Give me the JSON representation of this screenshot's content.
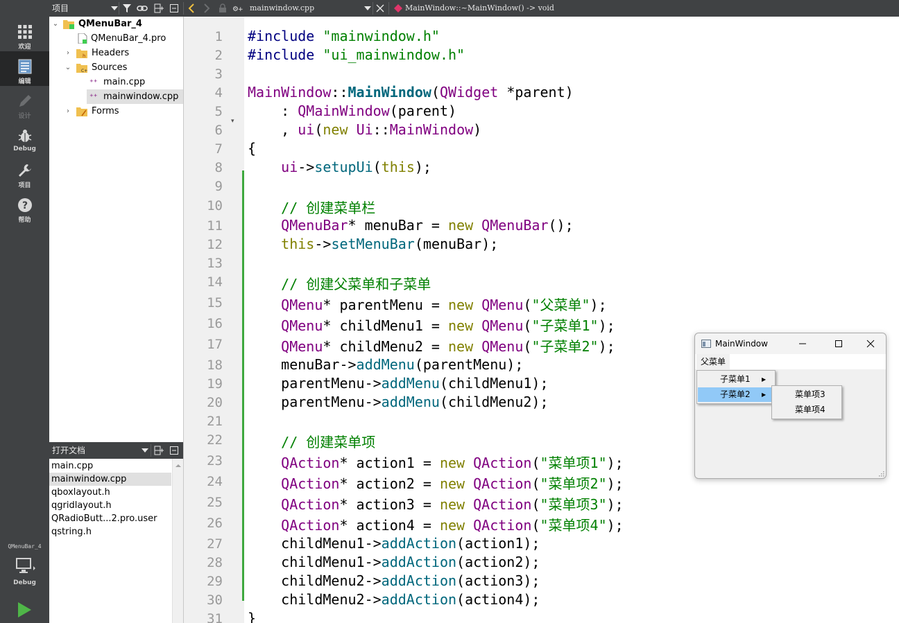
{
  "modebar": {
    "modes": [
      {
        "label": "欢迎",
        "icon": "grid-icon"
      },
      {
        "label": "编辑",
        "icon": "document-icon"
      },
      {
        "label": "设计",
        "icon": "pencil-icon"
      },
      {
        "label": "Debug",
        "icon": "bug-icon"
      },
      {
        "label": "项目",
        "icon": "wrench-icon"
      },
      {
        "label": "帮助",
        "icon": "help-icon"
      }
    ],
    "kit": {
      "project": "QMenuBar_4",
      "build": "Debug"
    }
  },
  "toolbar": {
    "pane_title": "项目",
    "file_name": "mainwindow.cpp",
    "symbol": "MainWindow::~MainWindow() -> void"
  },
  "project_tree": {
    "root": "QMenuBar_4",
    "items": [
      {
        "label": "QMenuBar_4.pro"
      },
      {
        "label": "Headers"
      },
      {
        "label": "Sources"
      },
      {
        "label": "main.cpp"
      },
      {
        "label": "mainwindow.cpp"
      },
      {
        "label": "Forms"
      }
    ]
  },
  "open_documents": {
    "title": "打开文档",
    "items": [
      "main.cpp",
      "mainwindow.cpp",
      "qboxlayout.h",
      "qgridlayout.h",
      "QRadioButt...2.pro.user",
      "qstring.h"
    ]
  },
  "editor": {
    "line_numbers": [
      "1",
      "2",
      "3",
      "4",
      "5",
      "6",
      "7",
      "8",
      "9",
      "10",
      "11",
      "12",
      "13",
      "14",
      "15",
      "16",
      "17",
      "18",
      "19",
      "20",
      "21",
      "22",
      "23",
      "24",
      "25",
      "26",
      "27",
      "28",
      "29",
      "30",
      "31"
    ],
    "lines": [
      [
        [
          "pp",
          "#include "
        ],
        [
          "str",
          "\"mainwindow.h\""
        ]
      ],
      [
        [
          "pp",
          "#include "
        ],
        [
          "str",
          "\"ui_mainwindow.h\""
        ]
      ],
      [],
      [
        [
          "typ",
          "MainWindow"
        ],
        [
          "",
          "::"
        ],
        [
          "fnb",
          "MainWindow"
        ],
        [
          "",
          "("
        ],
        [
          "typ",
          "QWidget"
        ],
        [
          "",
          " *parent)"
        ]
      ],
      [
        [
          "",
          "    : "
        ],
        [
          "typ",
          "QMainWindow"
        ],
        [
          "",
          "(parent)"
        ]
      ],
      [
        [
          "",
          "    , "
        ],
        [
          "typ",
          "ui"
        ],
        [
          "",
          "("
        ],
        [
          "kw",
          "new"
        ],
        [
          "",
          " "
        ],
        [
          "typ",
          "Ui"
        ],
        [
          "",
          "::"
        ],
        [
          "typ",
          "MainWindow"
        ],
        [
          "",
          ")"
        ]
      ],
      [
        [
          "",
          "{"
        ]
      ],
      [
        [
          "",
          "    "
        ],
        [
          "typ",
          "ui"
        ],
        [
          "",
          "->"
        ],
        [
          "fn",
          "setupUi"
        ],
        [
          "",
          "("
        ],
        [
          "kw",
          "this"
        ],
        [
          "",
          ");"
        ]
      ],
      [],
      [
        [
          "cmt",
          "    // 创建菜单栏"
        ]
      ],
      [
        [
          "",
          "    "
        ],
        [
          "typ",
          "QMenuBar"
        ],
        [
          "",
          "* menuBar = "
        ],
        [
          "kw",
          "new"
        ],
        [
          "",
          " "
        ],
        [
          "typ",
          "QMenuBar"
        ],
        [
          "",
          "();"
        ]
      ],
      [
        [
          "",
          "    "
        ],
        [
          "kw",
          "this"
        ],
        [
          "",
          "->"
        ],
        [
          "fn",
          "setMenuBar"
        ],
        [
          "",
          "(menuBar);"
        ]
      ],
      [],
      [
        [
          "cmt",
          "    // 创建父菜单和子菜单"
        ]
      ],
      [
        [
          "",
          "    "
        ],
        [
          "typ",
          "QMenu"
        ],
        [
          "",
          "* parentMenu = "
        ],
        [
          "kw",
          "new"
        ],
        [
          "",
          " "
        ],
        [
          "typ",
          "QMenu"
        ],
        [
          "",
          "("
        ],
        [
          "str",
          "\"父菜单\""
        ],
        [
          "",
          ");"
        ]
      ],
      [
        [
          "",
          "    "
        ],
        [
          "typ",
          "QMenu"
        ],
        [
          "",
          "* childMenu1 = "
        ],
        [
          "kw",
          "new"
        ],
        [
          "",
          " "
        ],
        [
          "typ",
          "QMenu"
        ],
        [
          "",
          "("
        ],
        [
          "str",
          "\"子菜单1\""
        ],
        [
          "",
          ");"
        ]
      ],
      [
        [
          "",
          "    "
        ],
        [
          "typ",
          "QMenu"
        ],
        [
          "",
          "* childMenu2 = "
        ],
        [
          "kw",
          "new"
        ],
        [
          "",
          " "
        ],
        [
          "typ",
          "QMenu"
        ],
        [
          "",
          "("
        ],
        [
          "str",
          "\"子菜单2\""
        ],
        [
          "",
          ");"
        ]
      ],
      [
        [
          "",
          "    menuBar->"
        ],
        [
          "fn",
          "addMenu"
        ],
        [
          "",
          "(parentMenu);"
        ]
      ],
      [
        [
          "",
          "    parentMenu->"
        ],
        [
          "fn",
          "addMenu"
        ],
        [
          "",
          "(childMenu1);"
        ]
      ],
      [
        [
          "",
          "    parentMenu->"
        ],
        [
          "fn",
          "addMenu"
        ],
        [
          "",
          "(childMenu2);"
        ]
      ],
      [],
      [
        [
          "cmt",
          "    // 创建菜单项"
        ]
      ],
      [
        [
          "",
          "    "
        ],
        [
          "typ",
          "QAction"
        ],
        [
          "",
          "* action1 = "
        ],
        [
          "kw",
          "new"
        ],
        [
          "",
          " "
        ],
        [
          "typ",
          "QAction"
        ],
        [
          "",
          "("
        ],
        [
          "str",
          "\"菜单项1\""
        ],
        [
          "",
          ");"
        ]
      ],
      [
        [
          "",
          "    "
        ],
        [
          "typ",
          "QAction"
        ],
        [
          "",
          "* action2 = "
        ],
        [
          "kw",
          "new"
        ],
        [
          "",
          " "
        ],
        [
          "typ",
          "QAction"
        ],
        [
          "",
          "("
        ],
        [
          "str",
          "\"菜单项2\""
        ],
        [
          "",
          ");"
        ]
      ],
      [
        [
          "",
          "    "
        ],
        [
          "typ",
          "QAction"
        ],
        [
          "",
          "* action3 = "
        ],
        [
          "kw",
          "new"
        ],
        [
          "",
          " "
        ],
        [
          "typ",
          "QAction"
        ],
        [
          "",
          "("
        ],
        [
          "str",
          "\"菜单项3\""
        ],
        [
          "",
          ");"
        ]
      ],
      [
        [
          "",
          "    "
        ],
        [
          "typ",
          "QAction"
        ],
        [
          "",
          "* action4 = "
        ],
        [
          "kw",
          "new"
        ],
        [
          "",
          " "
        ],
        [
          "typ",
          "QAction"
        ],
        [
          "",
          "("
        ],
        [
          "str",
          "\"菜单项4\""
        ],
        [
          "",
          ");"
        ]
      ],
      [
        [
          "",
          "    childMenu1->"
        ],
        [
          "fn",
          "addAction"
        ],
        [
          "",
          "(action1);"
        ]
      ],
      [
        [
          "",
          "    childMenu1->"
        ],
        [
          "fn",
          "addAction"
        ],
        [
          "",
          "(action2);"
        ]
      ],
      [
        [
          "",
          "    childMenu2->"
        ],
        [
          "fn",
          "addAction"
        ],
        [
          "",
          "(action3);"
        ]
      ],
      [
        [
          "",
          "    childMenu2->"
        ],
        [
          "fn",
          "addAction"
        ],
        [
          "",
          "(action4);"
        ]
      ],
      [
        [
          "",
          "}"
        ]
      ]
    ]
  },
  "app_window": {
    "title": "MainWindow",
    "menubar_label": "父菜单",
    "parent_menu_items": [
      "子菜单1",
      "子菜单2"
    ],
    "child_menu_items": [
      "菜单项3",
      "菜单项4"
    ]
  },
  "colors": {
    "sidebar": "#404244",
    "active_mode": "#262728",
    "gutter": "#f0f0f0",
    "changebar": "#3ea83e",
    "menu_highlight": "#91c9f7"
  }
}
